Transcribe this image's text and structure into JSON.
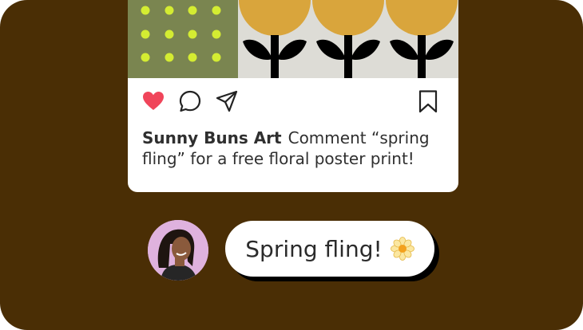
{
  "post": {
    "username": "Sunny Buns Art",
    "caption": "Comment “spring fling” for a free floral poster print!",
    "liked": true,
    "actions": {
      "like_icon": "heart-icon",
      "comment_icon": "comment-bubble-icon",
      "share_icon": "paper-plane-icon",
      "save_icon": "bookmark-icon"
    }
  },
  "comment_reply": {
    "text": "Spring fling!",
    "emoji_icon": "daisy-emoji"
  },
  "colors": {
    "background": "#4a2e05",
    "card": "#ffffff",
    "like_red": "#f0455a",
    "tile_olive": "#7a8550",
    "tile_dot": "#d4ec32",
    "flower_yellow": "#d9a53c",
    "avatar_bg": "#dfb2de"
  }
}
